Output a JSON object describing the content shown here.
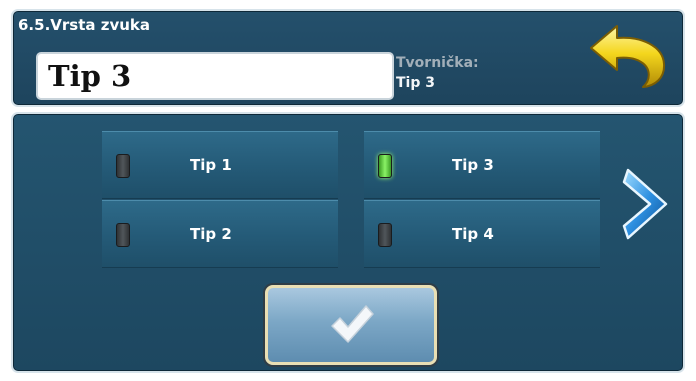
{
  "header": {
    "title": "6.5.Vrsta zvuka",
    "current_value": "Tip 3",
    "factory_label": "Tvornička:",
    "factory_value": "Tip 3"
  },
  "options": [
    {
      "label": "Tip 1",
      "selected": false
    },
    {
      "label": "Tip 2",
      "selected": false
    },
    {
      "label": "Tip 3",
      "selected": true
    },
    {
      "label": "Tip 4",
      "selected": false
    }
  ],
  "icons": {
    "back": "back-arrow-icon",
    "next": "chevron-right-icon",
    "confirm": "checkmark-icon"
  },
  "colors": {
    "panel": "#1e445d",
    "led_on": "#8af266",
    "led_off": "#50565a",
    "back_arrow": "#f2d21b",
    "next_arrow": "#2d8fe0"
  }
}
